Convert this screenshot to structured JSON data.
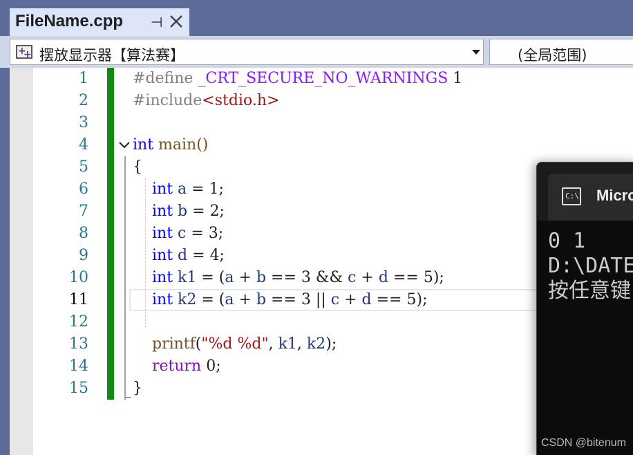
{
  "tab": {
    "title": "FileName.cpp",
    "pin_icon": "pin-icon",
    "close_icon": "close-icon"
  },
  "navbar": {
    "project": "摆放显示器【算法赛】",
    "scope": "(全局范围)"
  },
  "editor": {
    "line_numbers": [
      "1",
      "2",
      "3",
      "4",
      "5",
      "6",
      "7",
      "8",
      "9",
      "10",
      "11",
      "12",
      "13",
      "14",
      "15"
    ],
    "current_line": "11",
    "lines": [
      "#define _CRT_SECURE_NO_WARNINGS 1",
      "#include<stdio.h>",
      "",
      "int main()",
      "{",
      "    int a = 1;",
      "    int b = 2;",
      "    int c = 3;",
      "    int d = 4;",
      "    int k1 = (a + b == 3 && c + d == 5);",
      "    int k2 = (a + b == 3 || c + d == 5);",
      "",
      "    printf(\"%d %d\", k1, k2);",
      "    return 0;",
      "}"
    ]
  },
  "console": {
    "title": "Micro",
    "output_line1": "0 1",
    "output_line2": "D:\\DATE",
    "output_line3": "按任意键"
  },
  "watermark": "CSDN @bitenum",
  "colors": {
    "keyword": "#0000ff",
    "string": "#a31515",
    "change_bar": "#108a10",
    "tab_strip": "#5d6b99"
  }
}
